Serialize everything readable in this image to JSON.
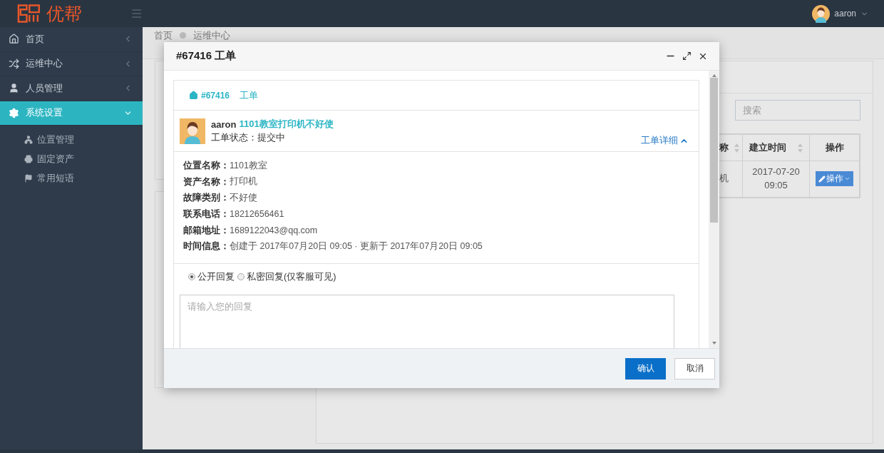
{
  "topbar": {
    "logo_text": "优帮",
    "user": "aaron"
  },
  "sidebar": {
    "items": [
      {
        "label": "首页",
        "kind": "home",
        "selected": false,
        "expanded": false
      },
      {
        "label": "运维中心",
        "kind": "shuffle",
        "selected": false,
        "expanded": false
      },
      {
        "label": "人员管理",
        "kind": "user",
        "selected": false,
        "expanded": false
      },
      {
        "label": "系统设置",
        "kind": "gear",
        "selected": true,
        "expanded": true,
        "children": [
          {
            "label": "位置管理",
            "kind": "sitemap",
            "selected": false
          },
          {
            "label": "固定资产",
            "kind": "printer",
            "selected": false
          },
          {
            "label": "常用短语",
            "kind": "flag",
            "selected": false
          }
        ]
      }
    ]
  },
  "breadcrumb": [
    "首页",
    "运维中心"
  ],
  "search": {
    "placeholder": "搜索"
  },
  "table": {
    "columns": [
      {
        "label": "称",
        "sortable": true
      },
      {
        "label": "建立时间",
        "sortable": true
      },
      {
        "label": "操作",
        "sortable": false
      }
    ],
    "rows": [
      {
        "cells": [
          "机",
          "2017-07-20 09:05"
        ],
        "action": "操作"
      }
    ]
  },
  "modal": {
    "title": "#67416 工单",
    "ticket_number": "#67416",
    "ticket_label": "工单",
    "author": "aaron",
    "subject": "1101教室打印机不好使",
    "status": "工单状态：提交中",
    "details_toggle": "工单详细",
    "details_expanded": true,
    "fields": [
      {
        "label": "位置名称：",
        "value": "1101教室"
      },
      {
        "label": "资产名称：",
        "value": "打印机"
      },
      {
        "label": "故障类别：",
        "value": "不好使"
      },
      {
        "label": "联系电话：",
        "value": "18212656461"
      },
      {
        "label": "邮箱地址：",
        "value": "1689122043@qq.com"
      },
      {
        "label": "时间信息：",
        "value": "创建于 2017年07月20日 09:05 · 更新于 2017年07月20日 09:05"
      }
    ],
    "reply_options": [
      {
        "label": "公开回复",
        "selected": true
      },
      {
        "label": "私密回复(仅客服可见)",
        "selected": false
      }
    ],
    "reply": {
      "placeholder": "请输入您的回复"
    },
    "buttons": [
      {
        "label": "确认",
        "kind": "primary"
      },
      {
        "label": "取消",
        "kind": "default"
      }
    ]
  }
}
